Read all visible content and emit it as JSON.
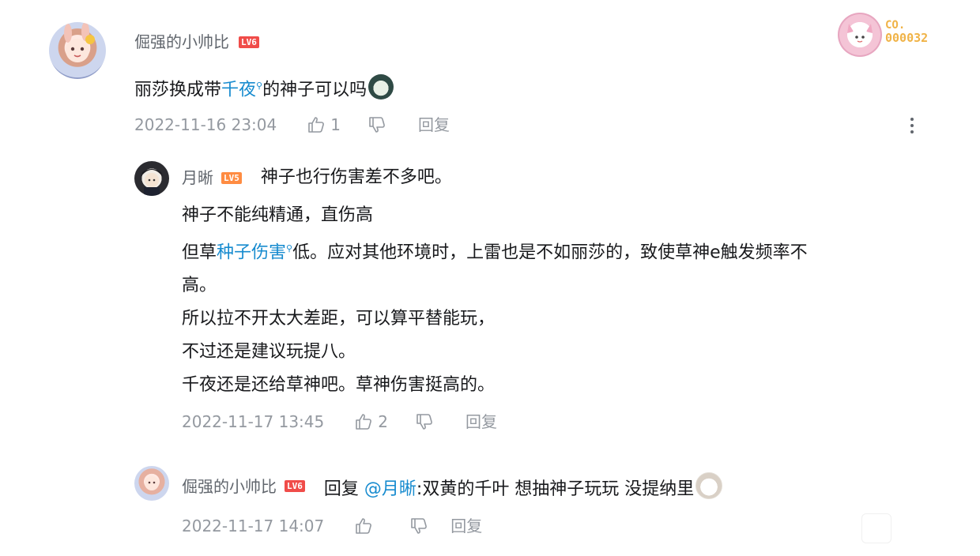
{
  "colors": {
    "link": "#178bcf",
    "meta": "#9499a0",
    "level6": "#f04c49",
    "level5": "#ff8c42"
  },
  "fan_badge": {
    "line1": "CO.",
    "line2": "000032"
  },
  "root_comment": {
    "username": "倔强的小帅比",
    "level": "LV6",
    "text_before": "丽莎换成带",
    "link": "千夜",
    "text_after": "的神子可以吗",
    "timestamp": "2022-11-16 23:04",
    "likes": "1",
    "reply_label": "回复"
  },
  "reply1": {
    "username": "月晰",
    "level": "LV5",
    "first_line": "神子也行伤害差不多吧。",
    "line2": "神子不能纯精通，直伤高",
    "line3_before": "但草",
    "line3_link": "种子伤害",
    "line3_after": "低。应对其他环境时，上雷也是不如丽莎的，致使草神e触发频率不",
    "line4": "高。",
    "line5": "所以拉不开太大差距，可以算平替能玩，",
    "line6": "不过还是建议玩提八。",
    "line7": "千夜还是还给草神吧。草神伤害挺高的。",
    "timestamp": "2022-11-17 13:45",
    "likes": "2",
    "reply_label": "回复"
  },
  "reply2": {
    "username": "倔强的小帅比",
    "level": "LV6",
    "prefix": "回复",
    "mention": "@月晰",
    "text": ":双黄的千叶 想抽神子玩玩 没提纳里",
    "timestamp": "2022-11-17 14:07",
    "reply_label": "回复"
  }
}
